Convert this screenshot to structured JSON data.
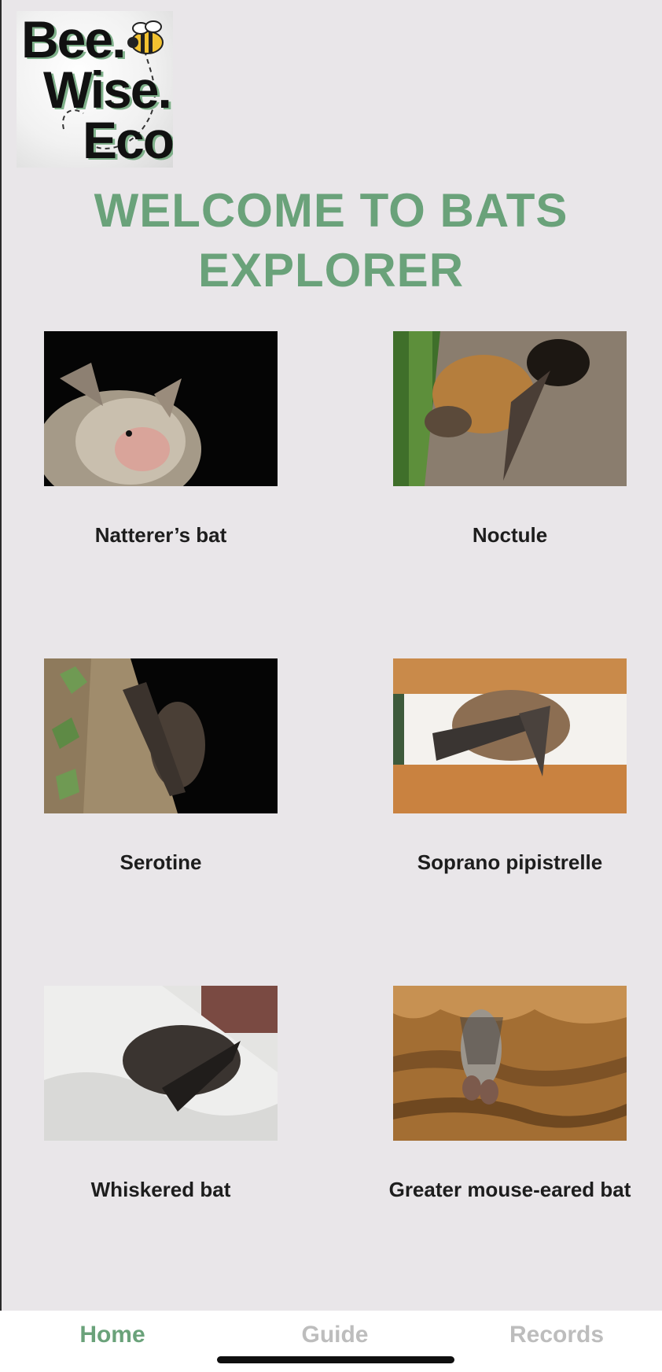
{
  "brand": {
    "logo_alt": "Bee. Wise. Eco.",
    "logo_words": [
      "Bee.",
      "Wise.",
      "Eco."
    ],
    "accent": "#6aa27a"
  },
  "header": {
    "title_line1": "WELCOME TO BATS",
    "title_line2": "EXPLORER"
  },
  "bats": [
    {
      "name": "Natterer’s bat",
      "photo": "natterers-bat-photo"
    },
    {
      "name": "Noctule",
      "photo": "noctule-photo"
    },
    {
      "name": "Serotine",
      "photo": "serotine-photo"
    },
    {
      "name": "Soprano pipistrelle",
      "photo": "soprano-pipistrelle-photo"
    },
    {
      "name": "Whiskered bat",
      "photo": "whiskered-bat-photo"
    },
    {
      "name": "Greater mouse-eared bat",
      "photo": "greater-mouse-eared-bat-photo"
    }
  ],
  "tabs": [
    {
      "label": "Home",
      "active": true
    },
    {
      "label": "Guide",
      "active": false
    },
    {
      "label": "Records",
      "active": false
    }
  ]
}
